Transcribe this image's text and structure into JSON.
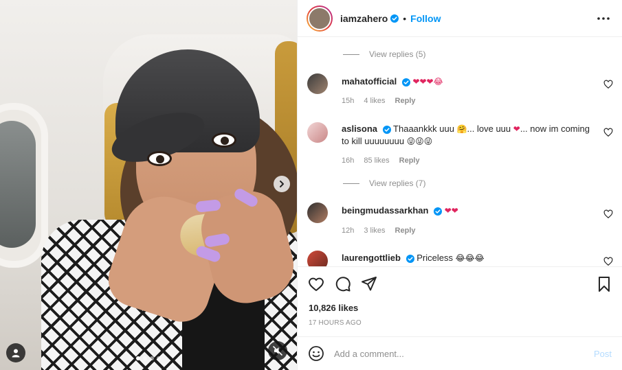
{
  "header": {
    "username": "iamzahero",
    "separator": "•",
    "follow_label": "Follow"
  },
  "comments": {
    "view_replies_1": "View replies (5)",
    "view_replies_2": "View replies (7)",
    "items": [
      {
        "username": "mahatofficial",
        "text": "",
        "emojis": "❤❤❤😂",
        "time": "15h",
        "likes": "4 likes",
        "reply": "Reply"
      },
      {
        "username": "aslisona",
        "text": "Thaaankkk uuu",
        "text_2": "... love uuu",
        "text_3": "... now im coming to kill uuuuuuuu",
        "emoji_a": "🤗",
        "emoji_b": "❤",
        "emoji_c": "😜😜😜",
        "time": "16h",
        "likes": "85 likes",
        "reply": "Reply"
      },
      {
        "username": "beingmudassarkhan",
        "emojis": "❤❤",
        "time": "12h",
        "likes": "3 likes",
        "reply": "Reply"
      },
      {
        "username": "laurengottlieb",
        "text": "Priceless",
        "emojis": "😂😂😂"
      }
    ]
  },
  "actions": {
    "likes": "10,826 likes",
    "time": "17 HOURS AGO"
  },
  "composer": {
    "placeholder": "Add a comment...",
    "post_label": "Post"
  },
  "media": {
    "slide_count": 4,
    "active_slide": 1
  },
  "colors": {
    "accent": "#0095f6",
    "text": "#262626",
    "muted": "#8e8e8e",
    "heart": "#e0245e",
    "post_disabled": "#b3dbff"
  }
}
